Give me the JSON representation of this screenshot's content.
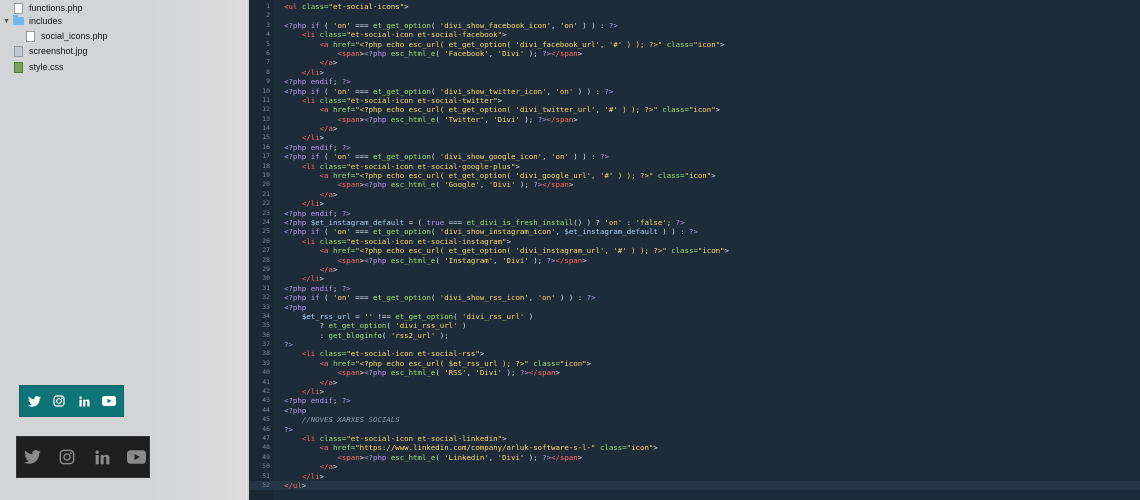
{
  "sidebar": {
    "items": [
      {
        "label": "functions.php",
        "icon": "php-file-icon"
      },
      {
        "label": "includes",
        "icon": "folder-icon",
        "expanded": true
      },
      {
        "label": "social_icons.php",
        "icon": "php-file-icon"
      },
      {
        "label": "screenshot.jpg",
        "icon": "image-file-icon"
      },
      {
        "label": "style.css",
        "icon": "css-file-icon"
      }
    ]
  },
  "widgets": {
    "teal": {
      "color": "#0f7477",
      "icons": [
        "twitter-icon",
        "instagram-icon",
        "linkedin-icon",
        "youtube-icon"
      ]
    },
    "dark": {
      "color": "#1f1f1f",
      "icons": [
        "twitter-icon",
        "instagram-icon",
        "linkedin-icon",
        "youtube-icon"
      ]
    }
  },
  "editor": {
    "active_line": 52,
    "lines": [
      "<ul class=\"et-social-icons\">",
      "",
      "<?php if ( 'on' === et_get_option( 'divi_show_facebook_icon', 'on' ) ) : ?>",
      "    <li class=\"et-social-icon et-social-facebook\">",
      "        <a href=\"<?php echo esc_url( et_get_option( 'divi_facebook_url', '#' ) ); ?>\" class=\"icon\">",
      "            <span><?php esc_html_e( 'Facebook', 'Divi' ); ?></span>",
      "        </a>",
      "    </li>",
      "<?php endif; ?>",
      "<?php if ( 'on' === et_get_option( 'divi_show_twitter_icon', 'on' ) ) : ?>",
      "    <li class=\"et-social-icon et-social-twitter\">",
      "        <a href=\"<?php echo esc_url( et_get_option( 'divi_twitter_url', '#' ) ); ?>\" class=\"icon\">",
      "            <span><?php esc_html_e( 'Twitter', 'Divi' ); ?></span>",
      "        </a>",
      "    </li>",
      "<?php endif; ?>",
      "<?php if ( 'on' === et_get_option( 'divi_show_google_icon', 'on' ) ) : ?>",
      "    <li class=\"et-social-icon et-social-google-plus\">",
      "        <a href=\"<?php echo esc_url( et_get_option( 'divi_google_url', '#' ) ); ?>\" class=\"icon\">",
      "            <span><?php esc_html_e( 'Google', 'Divi' ); ?></span>",
      "        </a>",
      "    </li>",
      "<?php endif; ?>",
      "<?php $et_instagram_default = ( true === et_divi_is_fresh_install() ) ? 'on' : 'false'; ?>",
      "<?php if ( 'on' === et_get_option( 'divi_show_instagram_icon', $et_instagram_default ) ) : ?>",
      "    <li class=\"et-social-icon et-social-instagram\">",
      "        <a href=\"<?php echo esc_url( et_get_option( 'divi_instagram_url', '#' ) ); ?>\" class=\"icon\">",
      "            <span><?php esc_html_e( 'Instagram', 'Divi' ); ?></span>",
      "        </a>",
      "    </li>",
      "<?php endif; ?>",
      "<?php if ( 'on' === et_get_option( 'divi_show_rss_icon', 'on' ) ) : ?>",
      "<?php",
      "    $et_rss_url = '' !== et_get_option( 'divi_rss_url' )",
      "        ? et_get_option( 'divi_rss_url' )",
      "        : get_bloginfo( 'rss2_url' );",
      "?>",
      "    <li class=\"et-social-icon et-social-rss\">",
      "        <a href=\"<?php echo esc_url( $et_rss_url ); ?>\" class=\"icon\">",
      "            <span><?php esc_html_e( 'RSS', 'Divi' ); ?></span>",
      "        </a>",
      "    </li>",
      "<?php endif; ?>",
      "<?php",
      "    //NOVES XARXES SOCIALS",
      "?>",
      "    <li class=\"et-social-icon et-social-linkedin\">",
      "        <a href=\"https://www.linkedin.com/company/arluk-software-s-l-\" class=\"icon\">",
      "            <span><?php esc_html_e( 'Linkedin', 'Divi' ); ?></span>",
      "        </a>",
      "    </li>",
      "</ul>"
    ]
  }
}
